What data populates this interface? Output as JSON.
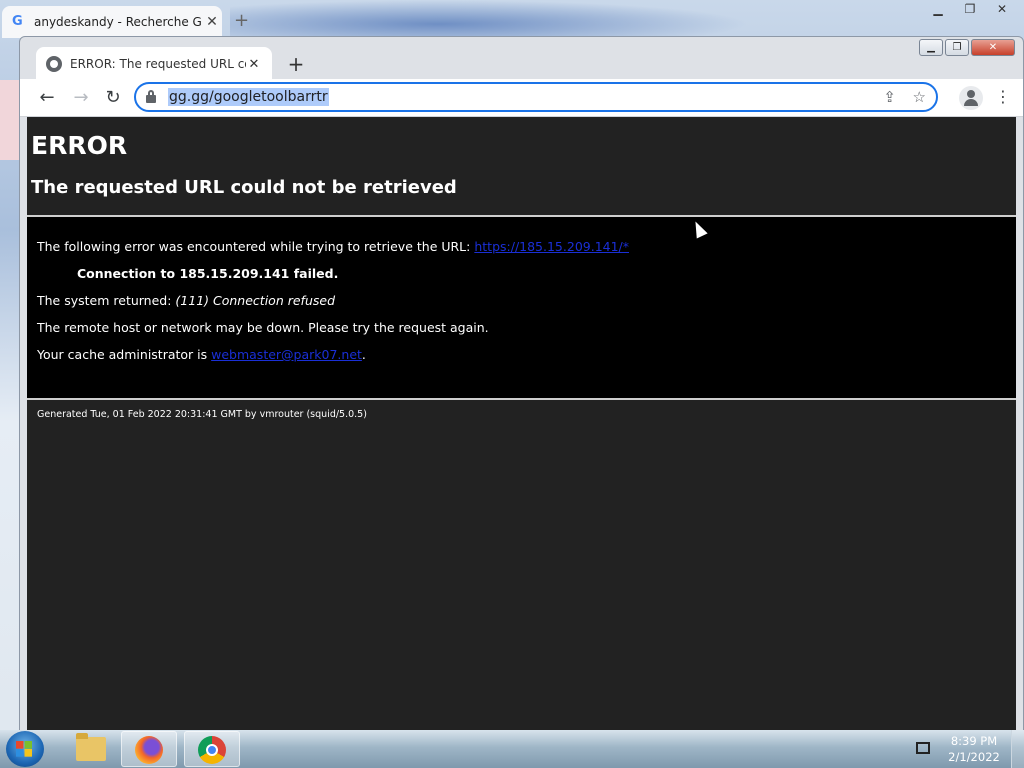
{
  "back_window": {
    "tab_title": "anydeskandy - Recherche Goog",
    "tab_icon": "google-g-icon"
  },
  "window": {
    "tab_title": "ERROR: The requested URL could",
    "tab_icon": "globe-icon",
    "controls": [
      "minimize",
      "maximize",
      "close"
    ]
  },
  "toolbar": {
    "url": "gg.gg/googletoolbarrtr"
  },
  "page": {
    "heading": "ERROR",
    "subheading": "The requested URL could not be retrieved",
    "line1_prefix": "The following error was encountered while trying to retrieve the URL: ",
    "line1_link": "https://185.15.209.141/*",
    "line2": "Connection to 185.15.209.141 failed.",
    "line3_prefix": "The system returned: ",
    "line3_detail": "(111) Connection refused",
    "line4": "The remote host or network may be down. Please try the request again.",
    "line5_prefix": "Your cache administrator is ",
    "line5_link": "webmaster@park07.net",
    "line5_suffix": ".",
    "footer": "Generated Tue, 01 Feb 2022 20:31:41 GMT by vmrouter (squid/5.0.5)"
  },
  "taskbar": {
    "items": [
      "explorer",
      "firefox",
      "chrome"
    ],
    "time": "8:39 PM",
    "date": "2/1/2022"
  },
  "colors": {
    "accent": "#1a73e8",
    "content_bg": "#222222",
    "error_box_bg": "#000000",
    "link": "#1a2fd6"
  }
}
